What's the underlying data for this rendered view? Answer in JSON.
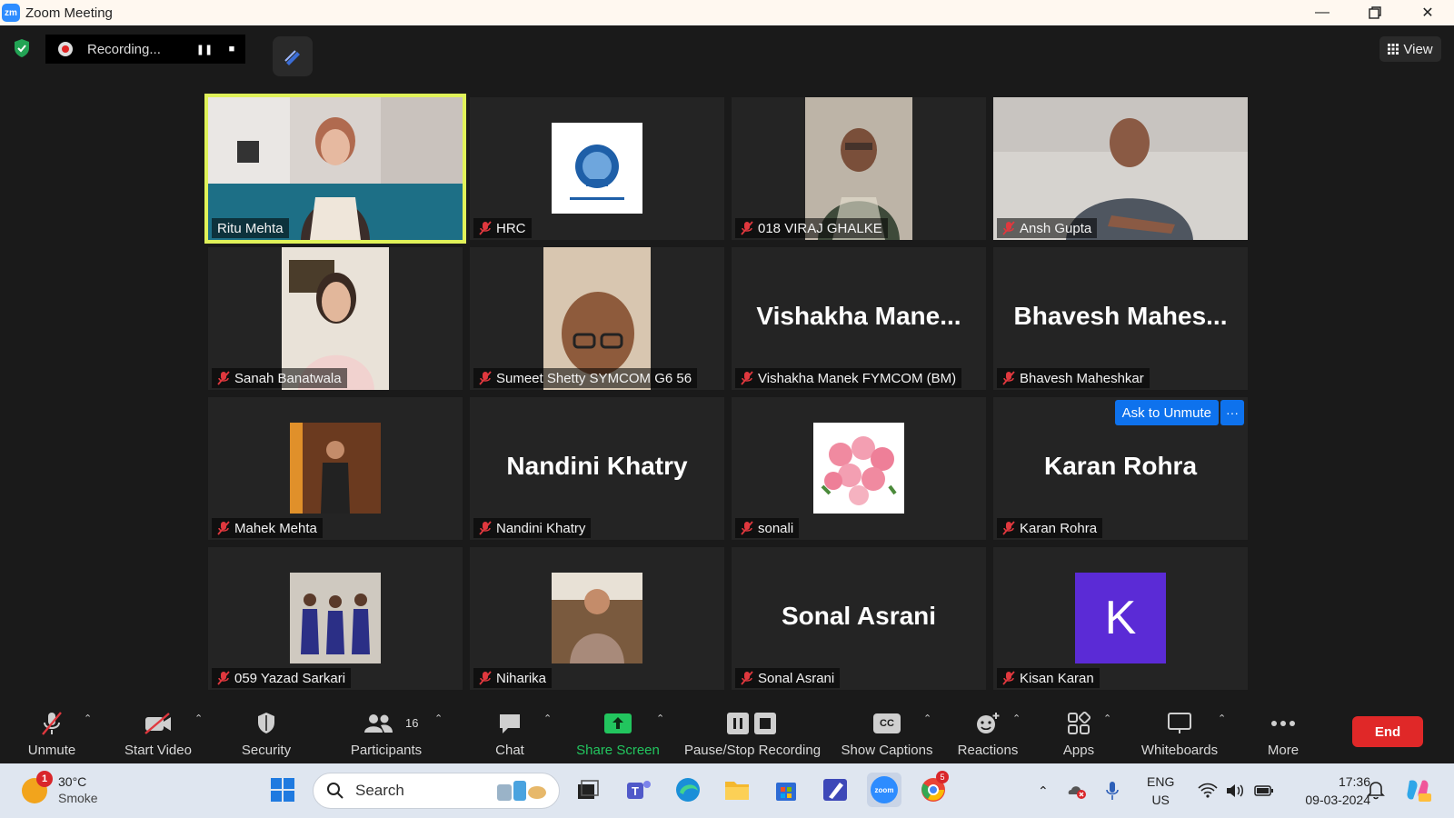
{
  "window": {
    "title": "Zoom Meeting",
    "logo_text": "zm"
  },
  "recording": {
    "status": "Recording..."
  },
  "view_button": {
    "label": "View"
  },
  "tiles": [
    {
      "name": "Ritu Mehta",
      "type": "video",
      "active": true,
      "muted": false
    },
    {
      "name": "HRC",
      "type": "logo",
      "muted": true
    },
    {
      "name": "018 VIRAJ GHALKE",
      "type": "video",
      "muted": true
    },
    {
      "name": "Ansh Gupta",
      "type": "video",
      "muted": true
    },
    {
      "name": "Sanah Banatwala",
      "type": "video",
      "muted": true
    },
    {
      "name": "Sumeet Shetty SYMCOM G6 56",
      "type": "video",
      "muted": true
    },
    {
      "name": "Vishakha Manek FYMCOM (BM)",
      "type": "name",
      "display": "Vishakha  Mane...",
      "muted": true
    },
    {
      "name": "Bhavesh Maheshkar",
      "type": "name",
      "display": "Bhavesh  Mahes...",
      "muted": true
    },
    {
      "name": "Mahek Mehta",
      "type": "photo",
      "muted": true
    },
    {
      "name": "Nandini Khatry",
      "type": "name",
      "display": "Nandini Khatry",
      "muted": true
    },
    {
      "name": "sonali",
      "type": "photo",
      "muted": true
    },
    {
      "name": "Karan Rohra",
      "type": "name",
      "display": "Karan Rohra",
      "muted": true
    },
    {
      "name": "059 Yazad Sarkari",
      "type": "photo",
      "muted": true
    },
    {
      "name": "Niharika",
      "type": "photo",
      "muted": true
    },
    {
      "name": "Sonal Asrani",
      "type": "name",
      "display": "Sonal Asrani",
      "muted": true
    },
    {
      "name": "Kisan Karan",
      "type": "avatar",
      "avatar_letter": "K",
      "muted": true
    }
  ],
  "hover_actions": {
    "ask_to_unmute": "Ask to Unmute",
    "more": "···"
  },
  "toolbar": {
    "unmute": "Unmute",
    "start_video": "Start Video",
    "security": "Security",
    "participants": "Participants",
    "participants_count": "16",
    "chat": "Chat",
    "share_screen": "Share Screen",
    "pause_stop_recording": "Pause/Stop Recording",
    "show_captions": "Show Captions",
    "reactions": "Reactions",
    "apps": "Apps",
    "whiteboards": "Whiteboards",
    "more": "More",
    "end": "End",
    "captions_icon_text": "CC"
  },
  "taskbar": {
    "weather_temp": "30°C",
    "weather_cond": "Smoke",
    "weather_badge": "1",
    "search_label": "Search",
    "lang_line1": "ENG",
    "lang_line2": "US",
    "time": "17:36",
    "date": "09-03-2024",
    "chrome_badge": "5",
    "zoom_icon_text": "zoom"
  },
  "colors": {
    "active_speaker": "#e0f259",
    "share_green": "#22c55e",
    "end_red": "#e02828",
    "ask_blue": "#0e72ed",
    "avatar_purple": "#5b2bd6"
  }
}
